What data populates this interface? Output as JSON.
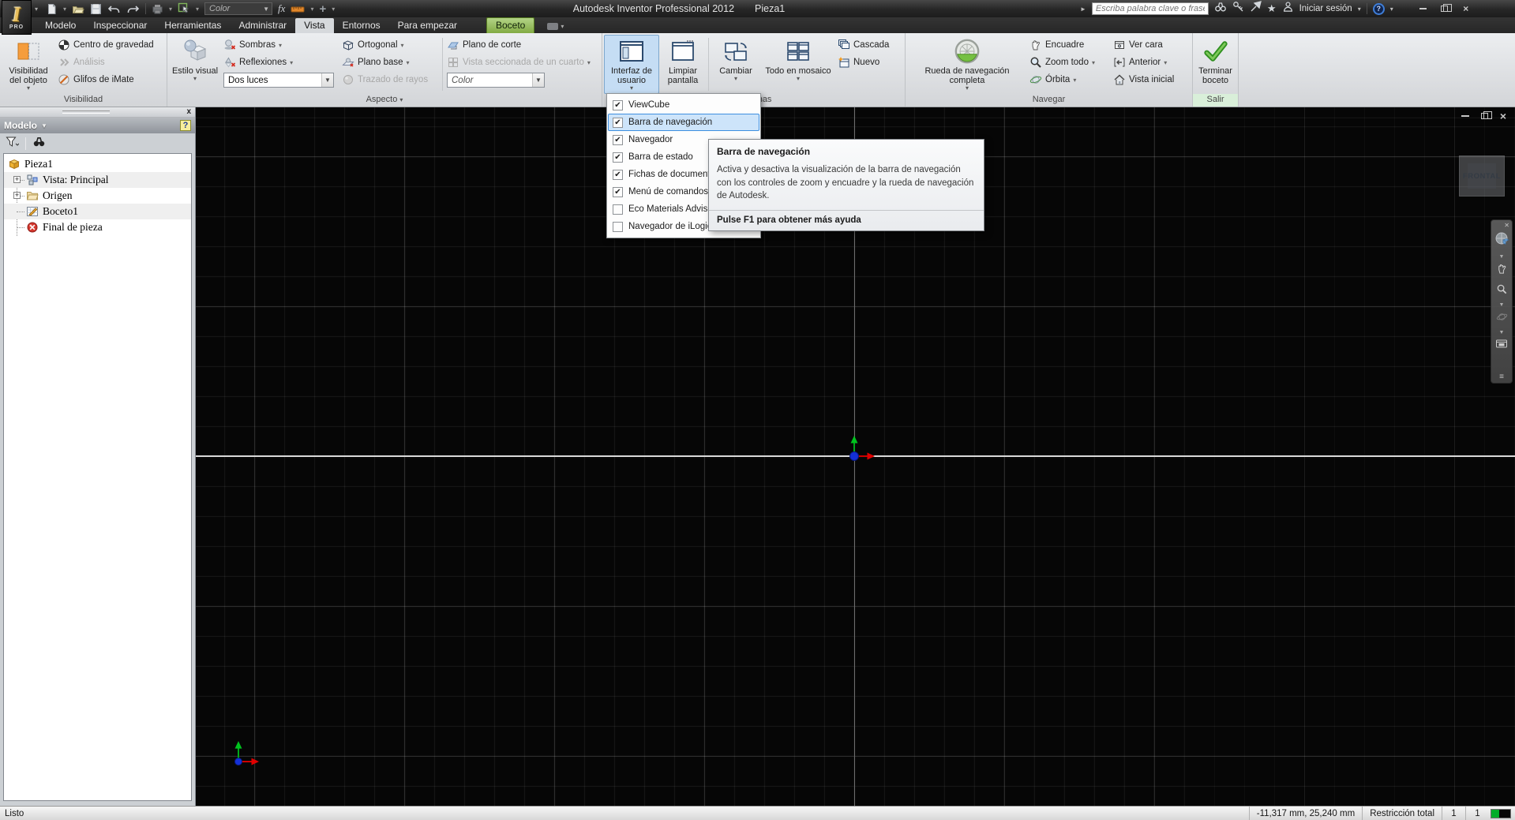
{
  "titlebar": {
    "logo": "I",
    "logo_sub": "PRO",
    "qat_color_combo": "Color",
    "fx_label": "fx",
    "title": "Autodesk Inventor Professional 2012",
    "document": "Pieza1",
    "search_placeholder": "Escriba palabra clave o frase",
    "signin_label": "Iniciar sesión"
  },
  "tabs": [
    {
      "label": "Modelo"
    },
    {
      "label": "Inspeccionar"
    },
    {
      "label": "Herramientas"
    },
    {
      "label": "Administrar"
    },
    {
      "label": "Vista"
    },
    {
      "label": "Entornos"
    },
    {
      "label": "Para empezar"
    },
    {
      "label": "Boceto"
    }
  ],
  "ribbon": {
    "visibilidad": {
      "label": "Visibilidad",
      "big": "Visibilidad del objeto",
      "items": [
        "Centro de gravedad",
        "Análisis",
        "Glifos de iMate"
      ]
    },
    "aspecto": {
      "label": "Aspecto",
      "big": "Estilo visual",
      "col1": [
        "Sombras",
        "Reflexiones"
      ],
      "combo1": "Dos luces",
      "col2": [
        "Ortogonal",
        "Plano base",
        "Trazado de rayos"
      ],
      "col3": [
        "Plano de corte",
        "Vista seccionada de un cuarto"
      ],
      "combo2": "Color"
    },
    "ventanas": {
      "label": "Ventanas",
      "big1": "Interfaz de usuario",
      "big2": "Limpiar pantalla",
      "big3": "Cambiar",
      "big4": "Todo en mosaico",
      "items": [
        "Cascada",
        "Nuevo"
      ]
    },
    "navegar": {
      "label": "Navegar",
      "big": "Rueda de navegación completa",
      "col1": [
        "Encuadre",
        "Zoom todo",
        "Órbita"
      ],
      "col2": [
        "Ver cara",
        "Anterior",
        "Vista inicial"
      ]
    },
    "salir": {
      "label": "Salir",
      "big": "Terminar boceto"
    }
  },
  "ui_menu": {
    "items": [
      {
        "label": "ViewCube",
        "check": "✔"
      },
      {
        "label": "Barra de navegación",
        "check": "✔",
        "highlighted": true
      },
      {
        "label": "Navegador",
        "check": "✔"
      },
      {
        "label": "Barra de estado",
        "check": "✔"
      },
      {
        "label": "Fichas de documentos",
        "check": "✔"
      },
      {
        "label": "Menú de comandos",
        "check": "✔"
      },
      {
        "label": "Eco Materials Adviser",
        "check": ""
      },
      {
        "label": "Navegador de iLogic",
        "check": ""
      }
    ]
  },
  "tooltip": {
    "title": "Barra de navegación",
    "body": "Activa y desactiva la visualización de la barra de navegación con los controles de zoom y encuadre y la rueda de navegación de Autodesk.",
    "footer": "Pulse F1 para obtener más ayuda"
  },
  "browser": {
    "header": "Modelo",
    "tree": [
      {
        "label": "Pieza1",
        "expander": ""
      },
      {
        "label": "Vista: Principal",
        "expander": "+"
      },
      {
        "label": "Origen",
        "expander": "+"
      },
      {
        "label": "Boceto1",
        "expander": ""
      },
      {
        "label": "Final de pieza",
        "expander": ""
      }
    ]
  },
  "canvas": {
    "viewcube_label": "FRONTAL"
  },
  "statusbar": {
    "left": "Listo",
    "coords": "-11,317 mm, 25,240 mm",
    "constraint": "Restricción total",
    "n1": "1",
    "n2": "1"
  },
  "colors": {
    "selection_blue": "#cde4fa",
    "highlight_button_blue": "#c5ddf4",
    "contextual_tab_green": "#82ab43",
    "canvas_bg": "#060606",
    "accent_orange": "#f59d3d"
  }
}
